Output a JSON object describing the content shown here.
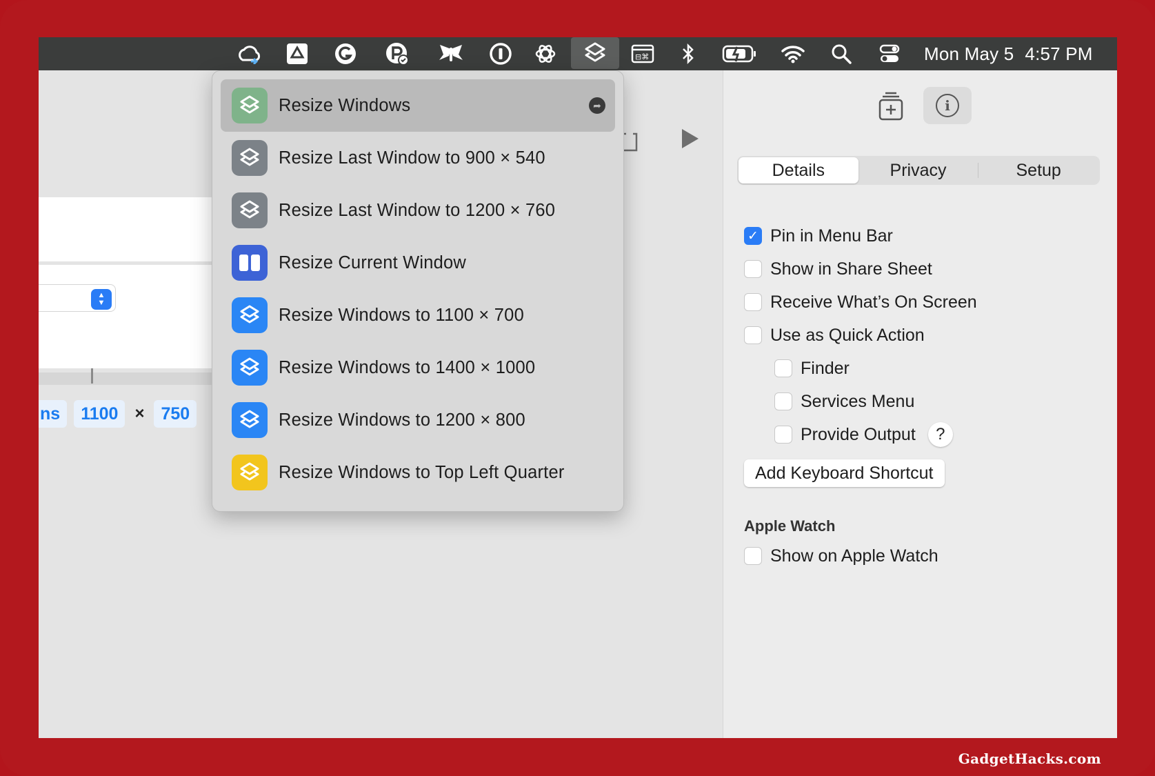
{
  "menubar": {
    "icons": [
      {
        "name": "creative-cloud-icon"
      },
      {
        "name": "drive-icon"
      },
      {
        "name": "grammarly-icon"
      },
      {
        "name": "parcel-icon"
      },
      {
        "name": "tes-icon"
      },
      {
        "name": "onepassword-icon"
      },
      {
        "name": "chatgpt-icon"
      },
      {
        "name": "shortcuts-icon"
      },
      {
        "name": "window-menu-icon"
      },
      {
        "name": "bluetooth-icon"
      },
      {
        "name": "battery-icon"
      },
      {
        "name": "wifi-icon"
      },
      {
        "name": "spotlight-search-icon"
      },
      {
        "name": "control-center-icon"
      }
    ],
    "date": "Mon May 5",
    "time": "4:57 PM"
  },
  "editor": {
    "token_prefix": "ns",
    "width_token": "1100",
    "times": "×",
    "height_token": "750"
  },
  "menu": {
    "items": [
      {
        "label": "Resize Windows",
        "color": "#7fb38a",
        "highlight": true
      },
      {
        "label": "Resize Last Window to 900 × 540",
        "color": "#7c8288"
      },
      {
        "label": "Resize Last Window to 1200 × 760",
        "color": "#7c8288"
      },
      {
        "label": "Resize Current Window",
        "color": "#3d63d6"
      },
      {
        "label": "Resize Windows to 1100 × 700",
        "color": "#2a86f5"
      },
      {
        "label": "Resize Windows to 1400 × 1000",
        "color": "#2a86f5"
      },
      {
        "label": "Resize Windows to 1200 × 800",
        "color": "#2a86f5"
      },
      {
        "label": "Resize Windows to Top Left Quarter",
        "color": "#f2c51d"
      }
    ]
  },
  "inspector": {
    "tabs": [
      "Details",
      "Privacy",
      "Setup"
    ],
    "options": {
      "pin_menu_bar": "Pin in Menu Bar",
      "share_sheet": "Show in Share Sheet",
      "receive_screen": "Receive What’s On Screen",
      "quick_action": "Use as Quick Action",
      "finder": "Finder",
      "services_menu": "Services Menu",
      "provide_output": "Provide Output",
      "help": "?"
    },
    "keyboard_shortcut": "Add Keyboard Shortcut",
    "apple_watch_heading": "Apple Watch",
    "show_watch": "Show on Apple Watch"
  },
  "watermark": "GadgetHacks.com"
}
